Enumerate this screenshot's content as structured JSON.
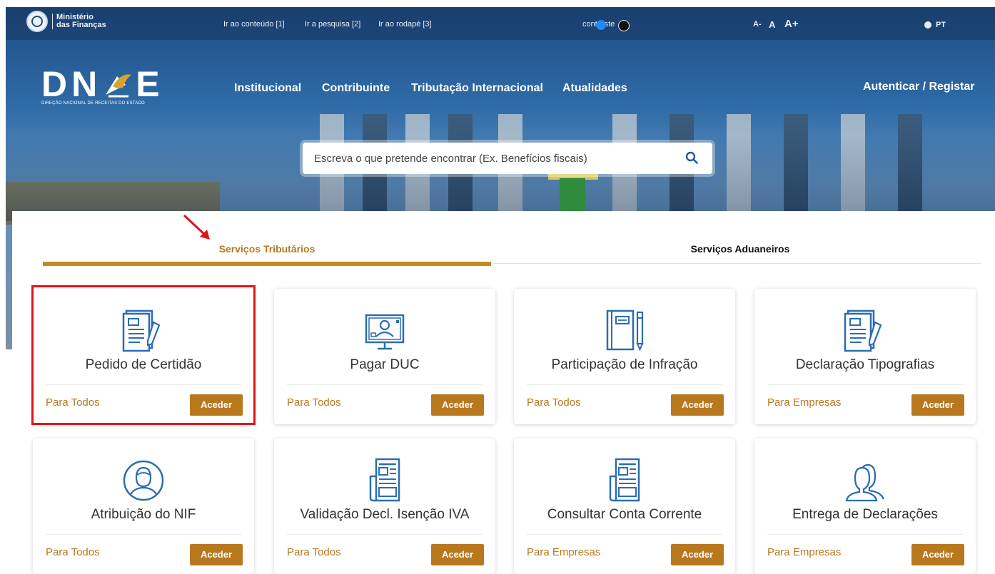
{
  "topbar": {
    "ministry_line1": "Ministério",
    "ministry_line2": "das Finanças",
    "skip_links": [
      "Ir ao conteúdo [1]",
      "Ir a pesquisa [2]",
      "Ir ao rodapé [3]"
    ],
    "contrast_label": "contraste",
    "font_small": "A-",
    "font_normal": "A",
    "font_large": "A+",
    "language": "PT",
    "colors": {
      "contrast_blue": "#1a8cff",
      "contrast_dark": "#111111"
    }
  },
  "header": {
    "logo_text": "DN",
    "logo_text_end": "E",
    "logo_subtitle": "DIREÇÃO NACIONAL DE RECEITAS DO ESTADO",
    "nav": [
      "Institucional",
      "Contribuinte",
      "Tributação Internacional",
      "Atualidades"
    ],
    "auth": "Autenticar / Registar"
  },
  "search": {
    "placeholder": "Escreva o que pretende encontrar (Ex. Benefícios fiscais)"
  },
  "tabs": {
    "active": "Serviços Tributários",
    "inactive": "Serviços Aduaneiros"
  },
  "cards": [
    {
      "icon": "document-pen-icon",
      "title": "Pedido de Certidão",
      "audience": "Para Todos",
      "button": "Aceder"
    },
    {
      "icon": "monitor-user-icon",
      "title": "Pagar DUC",
      "audience": "Para Todos",
      "button": "Aceder"
    },
    {
      "icon": "notebook-pencil-icon",
      "title": "Participação de Infração",
      "audience": "Para Todos",
      "button": "Aceder"
    },
    {
      "icon": "document-pen-icon",
      "title": "Declaração Tipografias",
      "audience": "Para Empresas",
      "button": "Aceder"
    },
    {
      "icon": "user-circle-icon",
      "title": "Atribuição do NIF",
      "audience": "Para Todos",
      "button": "Aceder"
    },
    {
      "icon": "newspaper-icon",
      "title": "Validação Decl. Isenção IVA",
      "audience": "Para Todos",
      "button": "Aceder"
    },
    {
      "icon": "newspaper-icon",
      "title": "Consultar Conta Corrente",
      "audience": "Para Empresas",
      "button": "Aceder"
    },
    {
      "icon": "users-icon",
      "title": "Entrega de Declarações",
      "audience": "Para Empresas",
      "button": "Aceder"
    }
  ],
  "colors": {
    "accent": "#b8781e",
    "icon": "#2a6db3",
    "highlight": "#e01515"
  }
}
